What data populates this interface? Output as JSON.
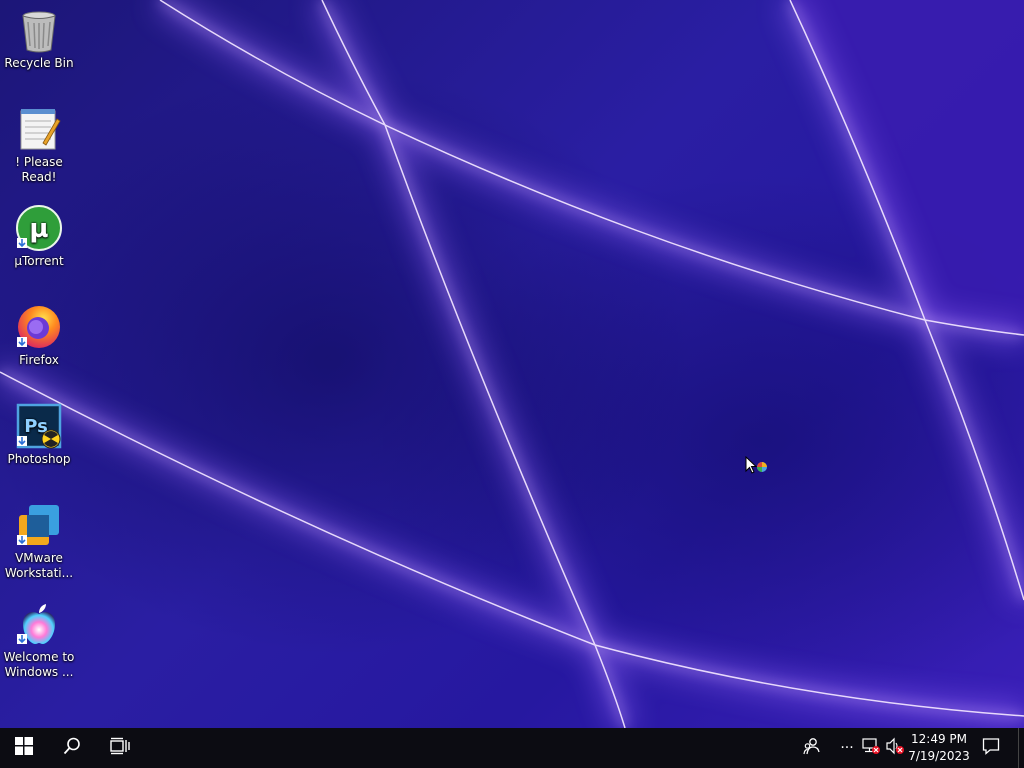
{
  "desktop": {
    "icons": [
      {
        "label": "Recycle Bin",
        "icon": "recycle-bin-icon"
      },
      {
        "label": "! Please Read!",
        "icon": "notepad-icon"
      },
      {
        "label": "µTorrent",
        "icon": "utorrent-icon"
      },
      {
        "label": "Firefox",
        "icon": "firefox-icon"
      },
      {
        "label": "Photoshop",
        "icon": "photoshop-icon"
      },
      {
        "label": "VMware\nWorkstati...",
        "label_line1": "VMware",
        "label_line2": "Workstati...",
        "icon": "vmware-icon"
      },
      {
        "label": "Welcome to\nWindows ...",
        "label_line1": "Welcome to",
        "label_line2": "Windows ...",
        "icon": "apple-icon"
      }
    ]
  },
  "taskbar": {
    "start_icon": "windows-logo-icon",
    "search_icon": "search-icon",
    "task_view_icon": "task-view-icon",
    "tray": {
      "people_icon": "people-icon",
      "overflow_label": "···",
      "network_icon": "network-disconnected-icon",
      "volume_icon": "volume-muted-icon",
      "time": "12:49 PM",
      "date": "7/19/2023",
      "notification_icon": "action-center-icon"
    }
  },
  "colors": {
    "wallpaper_base": "#241a8c",
    "wallpaper_light": "#b48cff",
    "taskbar": "#0c0c12"
  }
}
